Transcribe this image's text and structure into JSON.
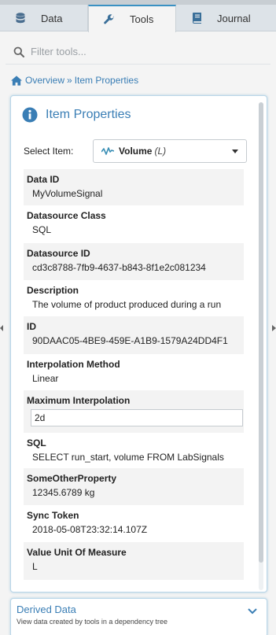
{
  "tabs": [
    {
      "label": "Data",
      "icon": "database-icon"
    },
    {
      "label": "Tools",
      "icon": "wrench-icon",
      "active": true
    },
    {
      "label": "Journal",
      "icon": "book-icon"
    }
  ],
  "filter": {
    "placeholder": "Filter tools..."
  },
  "breadcrumb": {
    "home": "Overview",
    "separator": "»",
    "current": "Item Properties"
  },
  "panel": {
    "title": "Item Properties",
    "select_label": "Select Item:",
    "selected_item": "Volume",
    "selected_item_suffix": "(L)"
  },
  "properties": [
    {
      "name": "Data ID",
      "value": "MyVolumeSignal"
    },
    {
      "name": "Datasource Class",
      "value": "SQL"
    },
    {
      "name": "Datasource ID",
      "value": "cd3c8788-7fb9-4637-b843-8f1e2c081234"
    },
    {
      "name": "Description",
      "value": "The volume of product produced during a run"
    },
    {
      "name": "ID",
      "value": "90DAAC05-4BE9-459E-A1B9-1579A24DD4F1"
    },
    {
      "name": "Interpolation Method",
      "value": "Linear"
    },
    {
      "name": "Maximum Interpolation",
      "value": "2d"
    },
    {
      "name": "SQL",
      "value": "SELECT run_start, volume FROM LabSignals"
    },
    {
      "name": "SomeOtherProperty",
      "value": "12345.6789 kg"
    },
    {
      "name": "Sync Token",
      "value": "2018-05-08T23:32:14.107Z"
    },
    {
      "name": "Value Unit Of Measure",
      "value": "L"
    }
  ],
  "derived": {
    "title": "Derived Data",
    "subtitle": "View data created by tools in a dependency tree"
  },
  "colors": {
    "accent": "#3a7eb5",
    "tab_active_border": "#3a91c3"
  }
}
